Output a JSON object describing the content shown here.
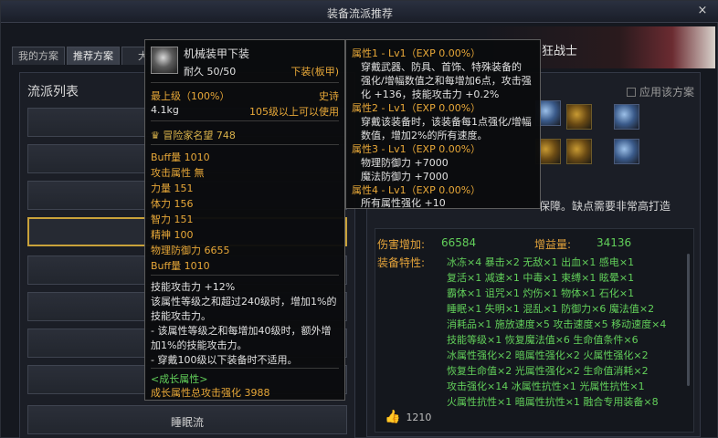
{
  "window": {
    "title": "装备流派推荐",
    "close": "×"
  },
  "tabs": [
    {
      "label": "我的方案"
    },
    {
      "label": "推荐方案"
    },
    {
      "label": "大神"
    }
  ],
  "banner": {
    "text": "狂战士"
  },
  "left": {
    "title": "流派列表",
    "items": [
      "",
      "",
      "",
      "",
      "",
      "",
      "",
      "",
      "睡眠流"
    ]
  },
  "right": {
    "apply_label": "应用该方案",
    "description": "保障。缺点需要非常高打造",
    "damage_label": "伤害增加:",
    "damage_value": "66584",
    "gain_label": "增益量:",
    "gain_value": "34136",
    "traits_label": "装备特性:",
    "traits": [
      "冰冻×4  暴击×2  无敌×1  出血×1  感电×1",
      "复活×1  减速×1  中毒×1  束缚×1  眩晕×1",
      "霸体×1  诅咒×1  灼伤×1  物体×1  石化×1",
      "睡眠×1  失明×1  混乱×1  防御力×6  魔法值×2",
      "消耗品×1  施放速度×5  攻击速度×5  移动速度×4",
      "技能等级×1  恢复魔法值×6  生命值条件×6",
      "冰属性强化×2  暗属性强化×2  火属性强化×2",
      "恢复生命值×2  光属性强化×2  生命值消耗×2",
      "攻击强化×14  冰属性抗性×1  光属性抗性×1",
      "火属性抗性×1  暗属性抗性×1  融合专用装备×8"
    ],
    "likes": "1210"
  },
  "tooltip1": {
    "name": "机械装甲下装",
    "durability": "耐久 50/50",
    "slot": "下装(板甲)",
    "level": "最上级（100%）",
    "rarity": "史诗",
    "weight": "4.1kg",
    "req": "105级以上可以使用",
    "fame": "冒险家名望 748",
    "stats": [
      "Buff量 1010",
      "攻击属性 無",
      "力量 151",
      "体力 156",
      "智力 151",
      "精神 100",
      "物理防御力 6655",
      "Buff量 1010"
    ],
    "desc": [
      "技能攻击力 +12%",
      "该属性等级之和超过240级时，增加1%的",
      "技能攻击力。",
      "- 该属性等级之和每增加40级时，额外增",
      "加1%的技能攻击力。",
      "- 穿戴100级以下装备时不适用。"
    ],
    "growth_title": "<成长属性>",
    "growth_value": "成长属性总攻击强化 3988"
  },
  "tooltip2": {
    "lines": [
      {
        "text": "属性1 - Lv1（EXP 0.00%）",
        "kind": "orange"
      },
      {
        "text": "穿戴武器、防具、首饰、特殊装备的",
        "kind": "white"
      },
      {
        "text": "强化/增幅数值之和每增加6点，攻击强",
        "kind": "white"
      },
      {
        "text": "化 +136，技能攻击力 +0.2%",
        "kind": "white"
      },
      {
        "text": "属性2 - Lv1（EXP 0.00%）",
        "kind": "orange"
      },
      {
        "text": "穿戴该装备时，该装备每1点强化/增幅",
        "kind": "white"
      },
      {
        "text": "数值，增加2%的所有速度。",
        "kind": "white"
      },
      {
        "text": "属性3 - Lv1（EXP 0.00%）",
        "kind": "orange"
      },
      {
        "text": "物理防御力 +7000",
        "kind": "white"
      },
      {
        "text": "魔法防御力 +7000",
        "kind": "white"
      },
      {
        "text": "属性4 - Lv1（EXP 0.00%）",
        "kind": "orange"
      },
      {
        "text": "所有属性强化 +10",
        "kind": "white"
      }
    ]
  },
  "colors": {
    "accent": "#c9a23a",
    "orange": "#e8a838",
    "green": "#62d05a"
  }
}
